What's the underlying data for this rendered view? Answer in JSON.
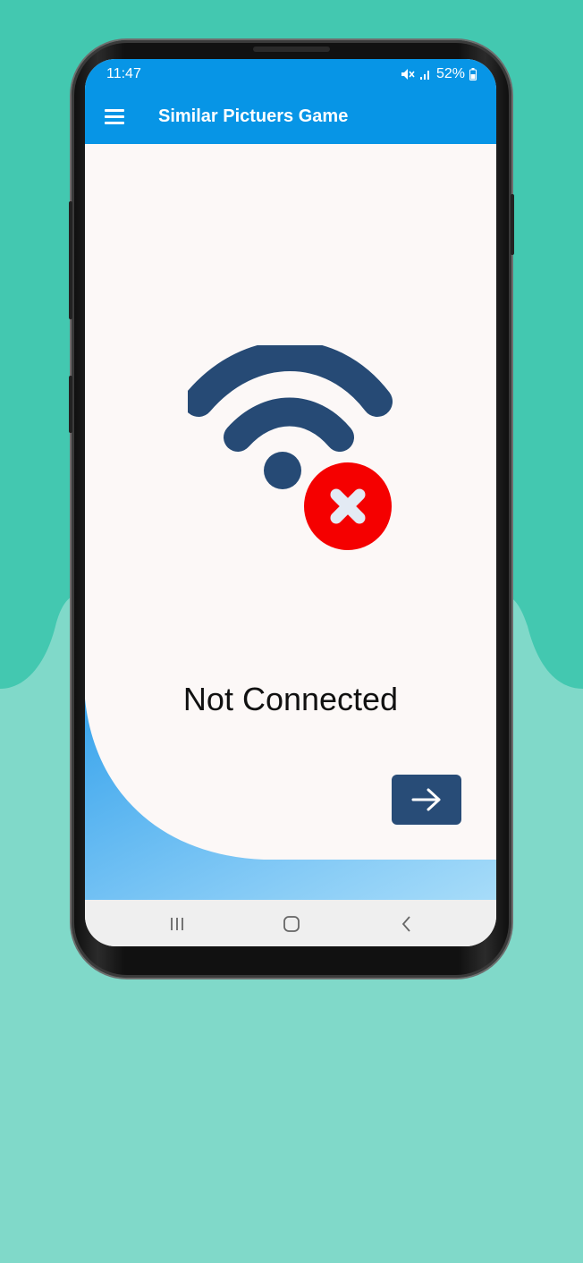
{
  "status_bar": {
    "time": "11:47",
    "battery_percent": "52%",
    "icons": [
      "mute-icon",
      "signal-icon",
      "battery-icon"
    ]
  },
  "app_bar": {
    "menu_icon": "hamburger-menu-icon",
    "title": "Similar Pictuers Game"
  },
  "main": {
    "illustration": "wifi-disconnected-icon",
    "message": "Not Connected",
    "next_button_icon": "arrow-right-icon"
  },
  "nav_bar": {
    "items": [
      "recent-apps-icon",
      "home-icon",
      "back-icon"
    ]
  },
  "colors": {
    "app_bar": "#0795e6",
    "wifi": "#264a75",
    "error_badge": "#f50000",
    "button": "#284c77",
    "background_teal": "#43c8b0"
  }
}
